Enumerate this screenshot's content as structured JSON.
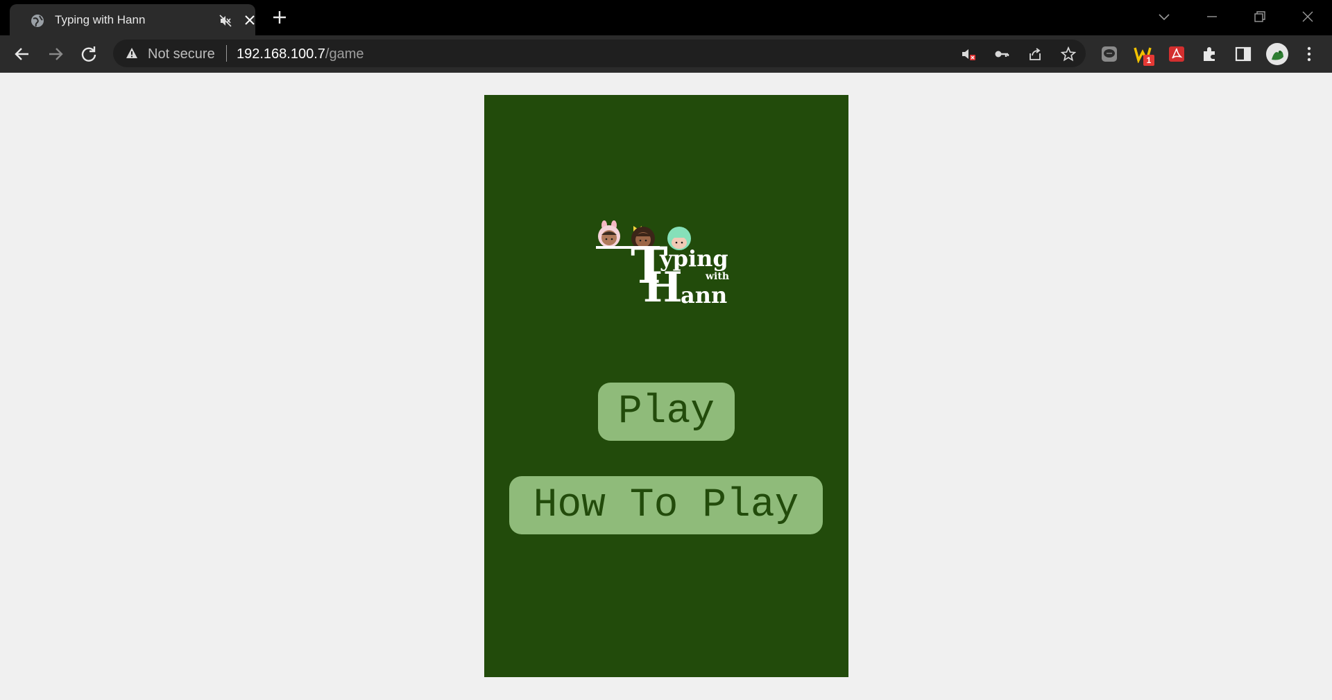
{
  "browser": {
    "tab": {
      "title": "Typing with Hann"
    },
    "omnibox": {
      "security_label": "Not secure",
      "url_host": "192.168.100.7",
      "url_path": "/game"
    },
    "extensions": {
      "badge_count": "1"
    }
  },
  "game": {
    "logo": {
      "word1_cap": "T",
      "word1_rest": "yping",
      "word2": "with",
      "word3_cap": "H",
      "word3_rest": "ann"
    },
    "buttons": {
      "play": "Play",
      "how_to_play": "How To Play"
    },
    "colors": {
      "background": "#224b0b",
      "button_fill": "#8fbb7a",
      "button_text": "#224b0b",
      "page_background": "#f0f0f0"
    }
  }
}
